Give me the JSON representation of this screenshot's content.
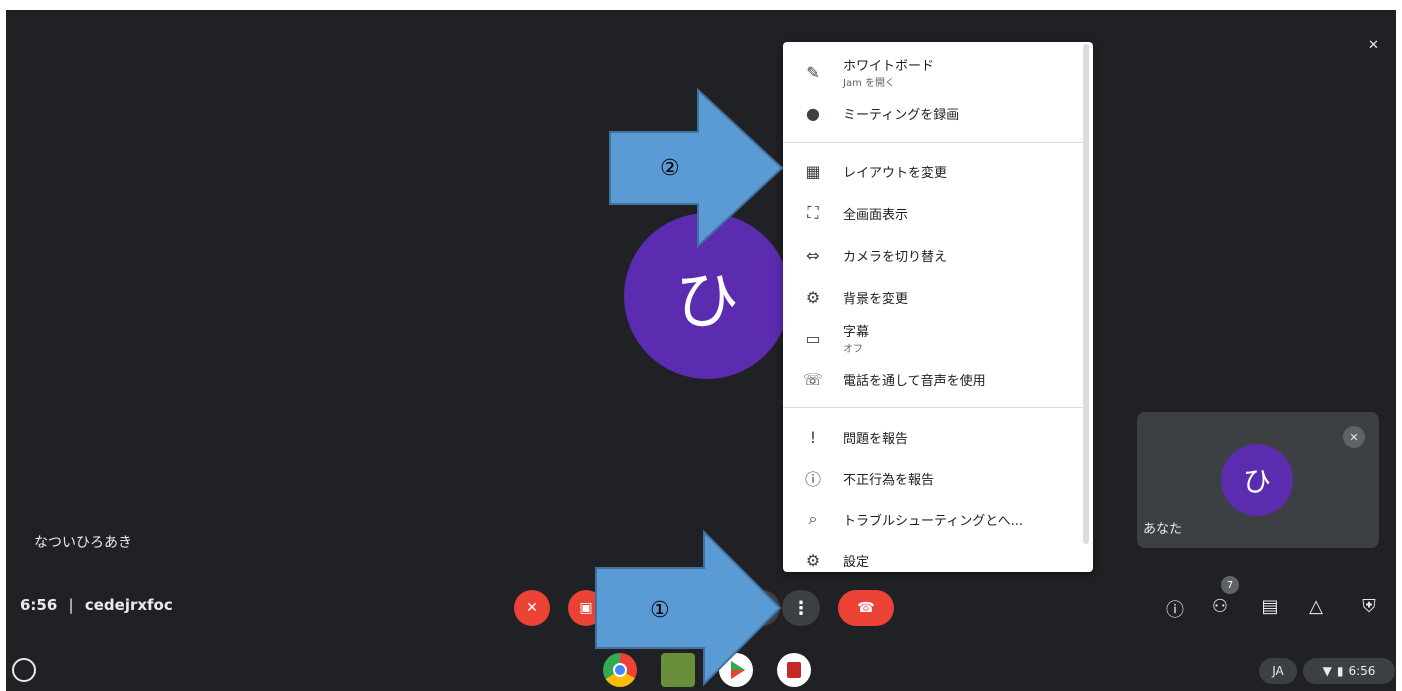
{
  "main_tile": {
    "avatar_letter": "ひ",
    "participant_name": "なついひろあき"
  },
  "self_tile": {
    "avatar_letter": "ひ",
    "label": "あなた"
  },
  "meeting": {
    "time": "6:56",
    "separator": "|",
    "code": "cedejrxfoc"
  },
  "participants_count": "7",
  "menu": {
    "items": [
      {
        "label": "ホワイトボード",
        "sub": "Jam を開く",
        "icon": "pen-icon",
        "glyph": "✎"
      },
      {
        "label": "ミーティングを録画",
        "icon": "record-icon",
        "glyph": "●"
      },
      {
        "label": "レイアウトを変更",
        "icon": "layout-icon",
        "glyph": "▦"
      },
      {
        "label": "全画面表示",
        "icon": "fullscreen-icon",
        "glyph": "⛶"
      },
      {
        "label": "カメラを切り替え",
        "icon": "camera-switch-icon",
        "glyph": "⇔"
      },
      {
        "label": "背景を変更",
        "icon": "background-icon",
        "glyph": "⚙"
      },
      {
        "label": "字幕",
        "sub": "オフ",
        "icon": "captions-icon",
        "glyph": "▭"
      },
      {
        "label": "電話を通して音声を使用",
        "icon": "phone-icon",
        "glyph": "☏"
      },
      {
        "label": "問題を報告",
        "icon": "report-problem-icon",
        "glyph": "!"
      },
      {
        "label": "不正行為を報告",
        "icon": "report-abuse-icon",
        "glyph": "ⓘ"
      },
      {
        "label": "トラブルシューティングとへ...",
        "icon": "troubleshoot-icon",
        "glyph": "⌕"
      },
      {
        "label": "設定",
        "icon": "settings-icon",
        "glyph": "⚙"
      }
    ]
  },
  "annotations": {
    "arrow1": "①",
    "arrow2": "②"
  },
  "system_tray": {
    "ime": "JA",
    "time": "6:56"
  },
  "colors": {
    "background": "#202124",
    "avatar": "#5b2bb0",
    "end_call": "#ea4335",
    "arrow": "#5b9bd5"
  }
}
